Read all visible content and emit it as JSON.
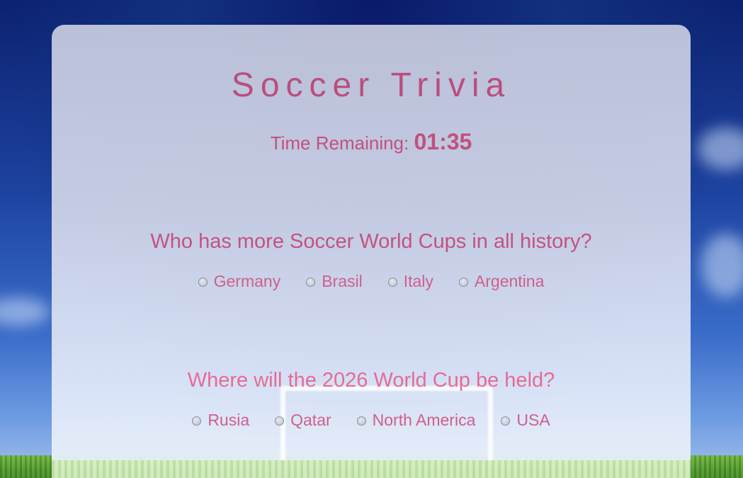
{
  "page": {
    "title": "Soccer Trivia"
  },
  "timer": {
    "label": "Time Remaining:",
    "value": "01:35"
  },
  "questions": [
    {
      "text": "Who has more Soccer World Cups in all history?",
      "options": [
        "Germany",
        "Brasil",
        "Italy",
        "Argentina"
      ]
    },
    {
      "text": "Where will the 2026 World Cup be held?",
      "options": [
        "Rusia",
        "Qatar",
        "North America",
        "USA"
      ]
    }
  ],
  "colors": {
    "accent": "#c2507f",
    "sky": "#1d43a0",
    "grass": "#4d8f2e"
  },
  "background": {
    "icon": "soccer-goal-icon"
  }
}
